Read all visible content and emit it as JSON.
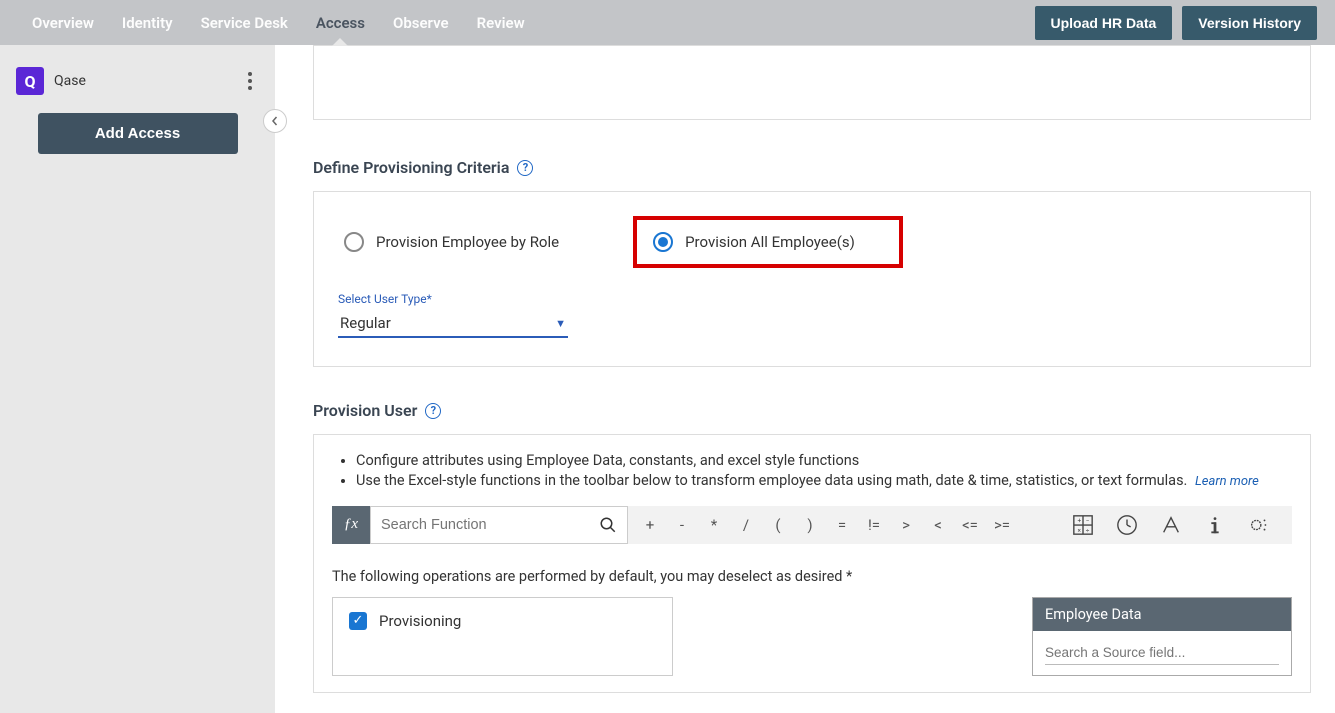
{
  "nav": {
    "tabs": [
      "Overview",
      "Identity",
      "Service Desk",
      "Access",
      "Observe",
      "Review"
    ],
    "active_index": 3,
    "upload_btn": "Upload HR Data",
    "version_btn": "Version History"
  },
  "sidebar": {
    "app_name": "Qase",
    "logo_letter": "Q",
    "add_access": "Add Access"
  },
  "criteria": {
    "title": "Define Provisioning Criteria",
    "radio1": "Provision Employee by Role",
    "radio2": "Provision All Employee(s)",
    "select_label": "Select User Type*",
    "select_value": "Regular"
  },
  "provision": {
    "title": "Provision User",
    "bullet1": "Configure attributes using Employee Data, constants, and excel style functions",
    "bullet2": "Use the Excel-style functions in the toolbar below to transform employee data using math, date & time, statistics, or text formulas.",
    "learn_more": "Learn more",
    "fx_label": "ƒx",
    "search_placeholder": "Search Function",
    "ops": [
      "+",
      "-",
      "*",
      "/",
      "(",
      ")",
      "=",
      "!=",
      ">",
      "<",
      "<=",
      ">="
    ],
    "ops_note": "The following operations are performed by default, you may deselect as desired *",
    "checkbox1": "Provisioning",
    "emp_header": "Employee Data",
    "emp_search_placeholder": "Search a Source field..."
  }
}
